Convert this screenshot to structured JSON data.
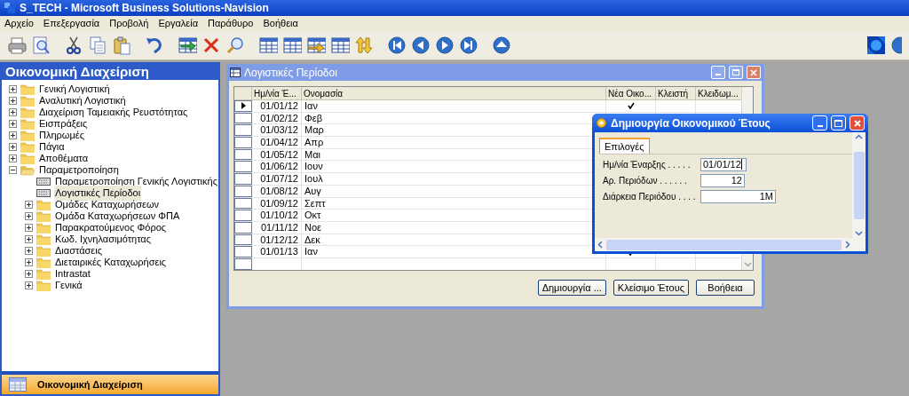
{
  "window": {
    "title": "S_TECH - Microsoft Business Solutions-Navision"
  },
  "menu": [
    "Αρχείο",
    "Επεξεργασία",
    "Προβολή",
    "Εργαλεία",
    "Παράθυρο",
    "Βοήθεια"
  ],
  "navigation_pane": {
    "title": "Οικονομική Διαχείριση",
    "tree": [
      {
        "label": "Γενική Λογιστική",
        "kind": "folder",
        "expanded": false,
        "selected": false
      },
      {
        "label": "Αναλυτική Λογιστική",
        "kind": "folder",
        "expanded": false,
        "selected": false
      },
      {
        "label": "Διαχείριση Ταμειακής Ρευστότητας",
        "kind": "folder",
        "expanded": false,
        "selected": false
      },
      {
        "label": "Εισπράξεις",
        "kind": "folder",
        "expanded": false,
        "selected": false
      },
      {
        "label": "Πληρωμές",
        "kind": "folder",
        "expanded": false,
        "selected": false
      },
      {
        "label": "Πάγια",
        "kind": "folder",
        "expanded": false,
        "selected": false
      },
      {
        "label": "Αποθέματα",
        "kind": "folder",
        "expanded": false,
        "selected": false
      },
      {
        "label": "Παραμετροποίηση",
        "kind": "folder",
        "expanded": true,
        "selected": false,
        "children": [
          {
            "label": "Παραμετροποίηση Γενικής Λογιστικής",
            "kind": "form",
            "selected": false
          },
          {
            "label": "Λογιστικές Περίοδοι",
            "kind": "form",
            "selected": true
          },
          {
            "label": "Ομάδες Καταχωρήσεων",
            "kind": "folder",
            "expanded": false,
            "selected": false
          },
          {
            "label": "Ομάδα Καταχωρήσεων ΦΠΑ",
            "kind": "folder",
            "expanded": false,
            "selected": false
          },
          {
            "label": "Παρακρατούμενος Φόρος",
            "kind": "folder",
            "expanded": false,
            "selected": false
          },
          {
            "label": "Κωδ. Ιχνηλασιμότητας",
            "kind": "folder",
            "expanded": false,
            "selected": false
          },
          {
            "label": "Διαστάσεις",
            "kind": "folder",
            "expanded": false,
            "selected": false
          },
          {
            "label": "Διεταιρικές Καταχωρήσεις",
            "kind": "folder",
            "expanded": false,
            "selected": false
          },
          {
            "label": "Intrastat",
            "kind": "folder",
            "expanded": false,
            "selected": false
          },
          {
            "label": "Γενικά",
            "kind": "folder",
            "expanded": false,
            "selected": false
          }
        ]
      }
    ],
    "bottom_button": "Οικονομική Διαχείριση"
  },
  "periods_window": {
    "title": "Λογιστικές Περίοδοι",
    "columns": [
      "Ημ/νία Έ...",
      "Ονομασία",
      "Νέα Οικο...",
      "Κλειστή",
      "Κλειδωμ..."
    ],
    "rows": [
      {
        "date": "01/01/12",
        "name": "Ιαν",
        "selected": true,
        "new_fiscal_year": true
      },
      {
        "date": "01/02/12",
        "name": "Φεβ",
        "selected": false
      },
      {
        "date": "01/03/12",
        "name": "Μαρ",
        "selected": false
      },
      {
        "date": "01/04/12",
        "name": "Απρ",
        "selected": false
      },
      {
        "date": "01/05/12",
        "name": "Μαι",
        "selected": false
      },
      {
        "date": "01/06/12",
        "name": "Ιουν",
        "selected": false
      },
      {
        "date": "01/07/12",
        "name": "Ιουλ",
        "selected": false
      },
      {
        "date": "01/08/12",
        "name": "Αυγ",
        "selected": false
      },
      {
        "date": "01/09/12",
        "name": "Σεπτ",
        "selected": false
      },
      {
        "date": "01/10/12",
        "name": "Οκτ",
        "selected": false
      },
      {
        "date": "01/11/12",
        "name": "Νοε",
        "selected": false
      },
      {
        "date": "01/12/12",
        "name": "Δεκ",
        "selected": false
      },
      {
        "date": "01/01/13",
        "name": "Ιαν",
        "selected": false,
        "new_fiscal_year": true
      }
    ],
    "buttons": [
      "Δημιουργία ...",
      "Κλείσιμο Έτους",
      "Βοήθεια"
    ]
  },
  "dialog": {
    "title": "Δημιουργία Οικονομικού Έτους",
    "tabs": [
      {
        "label": "Επιλογές",
        "selected": true
      }
    ],
    "fields": [
      {
        "label": "Ημ/νία Έναρξης . . . . .",
        "value": "01/01/12",
        "focused": true
      },
      {
        "label": "Αρ. Περιόδων . . . . . .",
        "value": "12",
        "focused": false
      },
      {
        "label": "Διάρκεια Περιόδου . . . .",
        "value": "1M",
        "focused": false
      }
    ]
  }
}
